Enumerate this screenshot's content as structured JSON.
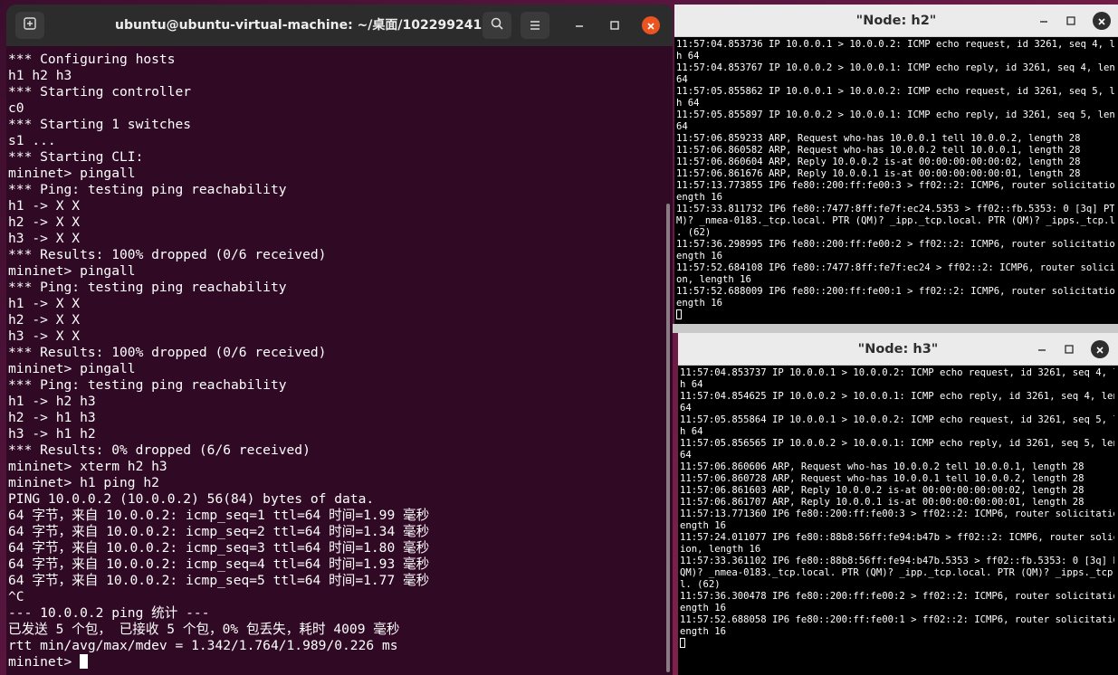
{
  "main_terminal": {
    "title": "ubuntu@ubuntu-virtual-machine: ~/桌面/102299241",
    "icons": {
      "new_tab": "new-tab-icon",
      "search": "search-icon",
      "menu": "hamburger-menu-icon",
      "minimize": "minimize-icon",
      "maximize": "maximize-icon",
      "close": "close-icon"
    },
    "lines": [
      "*** Configuring hosts",
      "h1 h2 h3",
      "*** Starting controller",
      "c0",
      "*** Starting 1 switches",
      "s1 ...",
      "*** Starting CLI:",
      "mininet> pingall",
      "*** Ping: testing ping reachability",
      "h1 -> X X",
      "h2 -> X X",
      "h3 -> X X",
      "*** Results: 100% dropped (0/6 received)",
      "mininet> pingall",
      "*** Ping: testing ping reachability",
      "h1 -> X X",
      "h2 -> X X",
      "h3 -> X X",
      "*** Results: 100% dropped (0/6 received)",
      "mininet> pingall",
      "*** Ping: testing ping reachability",
      "h1 -> h2 h3",
      "h2 -> h1 h3",
      "h3 -> h1 h2",
      "*** Results: 0% dropped (6/6 received)",
      "mininet> xterm h2 h3",
      "mininet> h1 ping h2",
      "PING 10.0.0.2 (10.0.0.2) 56(84) bytes of data.",
      "64 字节，来自 10.0.0.2: icmp_seq=1 ttl=64 时间=1.99 毫秒",
      "64 字节，来自 10.0.0.2: icmp_seq=2 ttl=64 时间=1.34 毫秒",
      "64 字节，来自 10.0.0.2: icmp_seq=3 ttl=64 时间=1.80 毫秒",
      "64 字节，来自 10.0.0.2: icmp_seq=4 ttl=64 时间=1.93 毫秒",
      "64 字节，来自 10.0.0.2: icmp_seq=5 ttl=64 时间=1.77 毫秒",
      "^C",
      "--- 10.0.0.2 ping 统计 ---",
      "已发送 5 个包， 已接收 5 个包，0% 包丢失，耗时 4009 毫秒",
      "rtt min/avg/max/mdev = 1.342/1.764/1.989/0.226 ms"
    ],
    "prompt": "mininet> "
  },
  "node_h2": {
    "title": "\"Node: h2\"",
    "lines": [
      "11:57:04.853736 IP 10.0.0.1 > 10.0.0.2: ICMP echo request, id 3261, seq 4, length",
      "h 64",
      "11:57:04.853767 IP 10.0.0.2 > 10.0.0.1: ICMP echo reply, id 3261, seq 4, length",
      "64",
      "11:57:05.855862 IP 10.0.0.1 > 10.0.0.2: ICMP echo request, id 3261, seq 5, length",
      "h 64",
      "11:57:05.855897 IP 10.0.0.2 > 10.0.0.1: ICMP echo reply, id 3261, seq 5, length",
      "64",
      "11:57:06.859233 ARP, Request who-has 10.0.0.1 tell 10.0.0.2, length 28",
      "11:57:06.860582 ARP, Request who-has 10.0.0.2 tell 10.0.0.1, length 28",
      "11:57:06.860604 ARP, Reply 10.0.0.2 is-at 00:00:00:00:00:02, length 28",
      "11:57:06.861676 ARP, Reply 10.0.0.1 is-at 00:00:00:00:00:01, length 28",
      "11:57:13.773855 IP6 fe80::200:ff:fe00:3 > ff02::2: ICMP6, router solicitation, l",
      "ength 16",
      "11:57:33.811732 IP6 fe80::7477:8ff:fe7f:ec24.5353 > ff02::fb.5353: 0 [3q] PTR (Q",
      "M)? _nmea-0183._tcp.local. PTR (QM)? _ipp._tcp.local. PTR (QM)? _ipps._tcp.local",
      ". (62)",
      "11:57:36.298995 IP6 fe80::200:ff:fe00:2 > ff02::2: ICMP6, router solicitation, l",
      "ength 16",
      "11:57:52.684108 IP6 fe80::7477:8ff:fe7f:ec24 > ff02::2: ICMP6, router solicitati",
      "on, length 16",
      "11:57:52.688009 IP6 fe80::200:ff:fe00:1 > ff02::2: ICMP6, router solicitation, l",
      "ength 16"
    ]
  },
  "node_h3": {
    "title": "\"Node: h3\"",
    "lines": [
      "11:57:04.853737 IP 10.0.0.1 > 10.0.0.2: ICMP echo request, id 3261, seq 4, length",
      "h 64",
      "11:57:04.854625 IP 10.0.0.2 > 10.0.0.1: ICMP echo reply, id 3261, seq 4, length",
      "64",
      "11:57:05.855864 IP 10.0.0.1 > 10.0.0.2: ICMP echo request, id 3261, seq 5, length",
      "h 64",
      "11:57:05.856565 IP 10.0.0.2 > 10.0.0.1: ICMP echo reply, id 3261, seq 5, length",
      "64",
      "11:57:06.860606 ARP, Request who-has 10.0.0.2 tell 10.0.0.1, length 28",
      "11:57:06.860728 ARP, Request who-has 10.0.0.1 tell 10.0.0.2, length 28",
      "11:57:06.861603 ARP, Reply 10.0.0.2 is-at 00:00:00:00:00:02, length 28",
      "11:57:06.861707 ARP, Reply 10.0.0.1 is-at 00:00:00:00:00:01, length 28",
      "11:57:13.771360 IP6 fe80::200:ff:fe00:3 > ff02::2: ICMP6, router solicitation, l",
      "ength 16",
      "11:57:24.011077 IP6 fe80::88b8:56ff:fe94:b47b > ff02::2: ICMP6, router solicitat",
      "ion, length 16",
      "11:57:33.361102 IP6 fe80::88b8:56ff:fe94:b47b.5353 > ff02::fb.5353: 0 [3q] PTR (",
      "QM)? _nmea-0183._tcp.local. PTR (QM)? _ipp._tcp.local. PTR (QM)? _ipps._tcp.loca",
      "l. (62)",
      "11:57:36.300478 IP6 fe80::200:ff:fe00:2 > ff02::2: ICMP6, router solicitation, l",
      "ength 16",
      "11:57:52.688058 IP6 fe80::200:ff:fe00:1 > ff02::2: ICMP6, router solicitation, l",
      "ength 16"
    ]
  },
  "colors": {
    "terminal_bg": "#300a24",
    "close_accent": "#e95420",
    "xterm_bg": "#000000",
    "xterm_titlebar": "#ebebeb"
  }
}
